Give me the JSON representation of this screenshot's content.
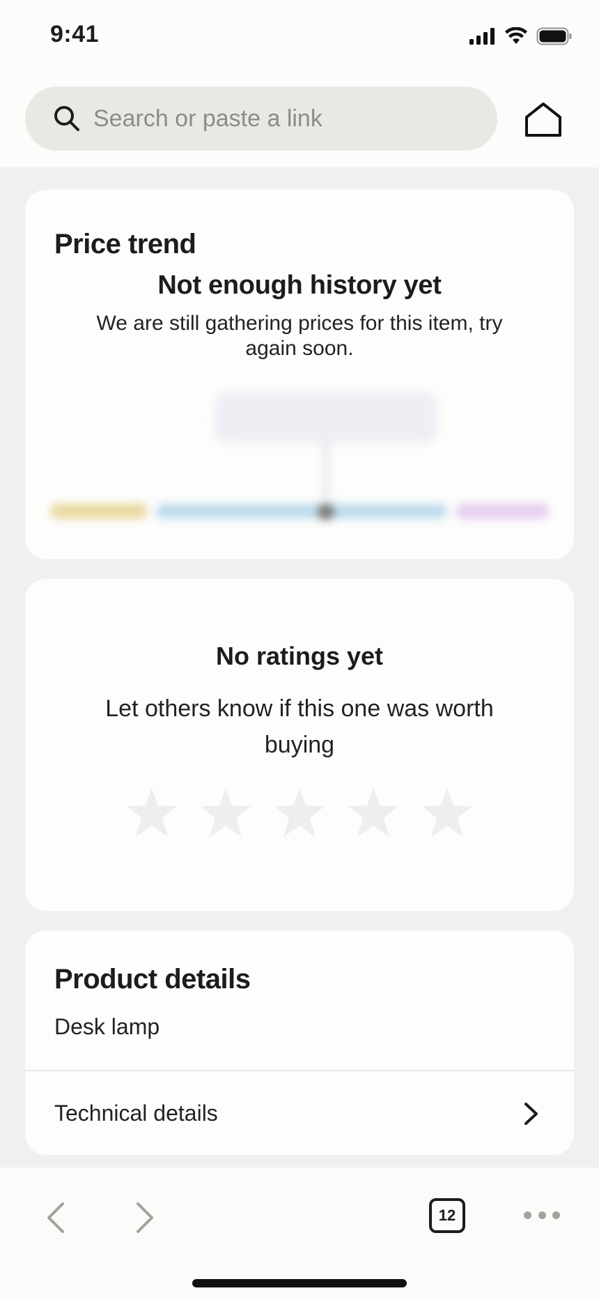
{
  "status_bar": {
    "time": "9:41"
  },
  "search": {
    "placeholder": "Search or paste a link"
  },
  "price_trend": {
    "title": "Price trend",
    "empty_title": "Not enough history yet",
    "empty_message": "We are still gathering prices for this item, try again soon."
  },
  "ratings": {
    "title": "No ratings yet",
    "message": "Let others know if this one was worth buying",
    "stars": 5,
    "star_color": "#efeeec"
  },
  "product_details": {
    "title": "Product details",
    "name": "Desk lamp",
    "technical_details_label": "Technical details"
  },
  "toolbar": {
    "tab_count": "12"
  },
  "colors": {
    "background": "#f1f0ee",
    "card": "#fdfdfc",
    "search_bg": "#e9e8e5"
  }
}
